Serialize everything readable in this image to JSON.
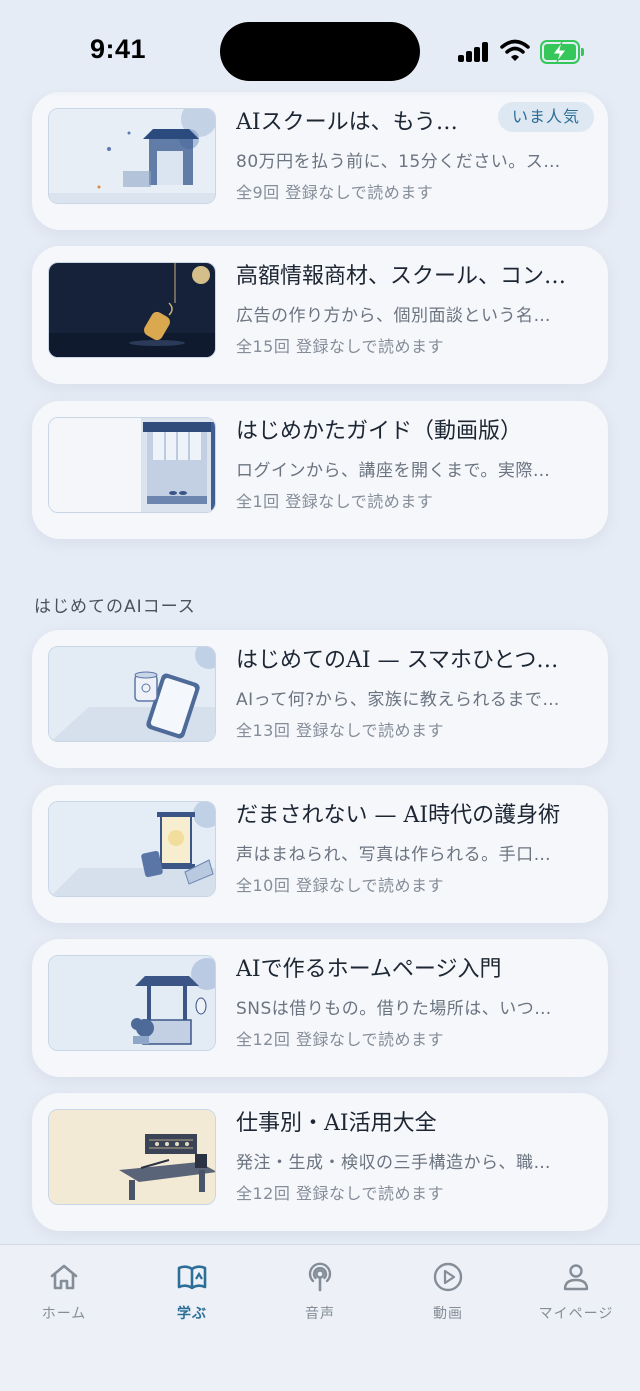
{
  "status_bar": {
    "time": "9:41"
  },
  "cards_top": [
    {
      "title": "AIスクールは、もう…",
      "description": "80万円を払う前に、15分ください。ス…",
      "meta": "全9回 登録なしで読めます",
      "badge": "いま人気",
      "image": "gate-illustration"
    },
    {
      "title": "高額情報商材、スクール、コン…",
      "description": "広告の作り方から、個別面談という名…",
      "meta": "全15回 登録なしで読めます",
      "image": "fishing-lure-illustration"
    },
    {
      "title": "はじめかたガイド（動画版）",
      "description": "ログインから、講座を開くまで。実際…",
      "meta": "全1回 登録なしで読めます",
      "image": "doorway-illustration"
    }
  ],
  "section": {
    "title": "はじめてのAIコース"
  },
  "cards_course": [
    {
      "title": "はじめてのAI — スマホひとつ…",
      "description": "AIって何?から、家族に教えられるまで…",
      "meta": "全13回 登録なしで読めます",
      "image": "phone-tea-illustration"
    },
    {
      "title": "だまされない — AI時代の護身術",
      "description": "声はまねられ、写真は作られる。手口…",
      "meta": "全10回 登録なしで読めます",
      "image": "lantern-illustration"
    },
    {
      "title": "AIで作るホームページ入門",
      "description": "SNSは借りもの。借りた場所は、いつ…",
      "meta": "全12回 登録なしで読めます",
      "image": "well-illustration"
    },
    {
      "title": "仕事別・AI活用大全",
      "description": "発注・生成・検収の三手構造から、職…",
      "meta": "全12回 登録なしで読めます",
      "image": "abacus-desk-illustration"
    }
  ],
  "tabs": [
    {
      "label": "ホーム",
      "icon": "home-icon",
      "active": false
    },
    {
      "label": "学ぶ",
      "icon": "book-icon",
      "active": true
    },
    {
      "label": "音声",
      "icon": "podcast-icon",
      "active": false
    },
    {
      "label": "動画",
      "icon": "play-icon",
      "active": false
    },
    {
      "label": "マイページ",
      "icon": "person-icon",
      "active": false
    }
  ],
  "colors": {
    "accent": "#2c6e97",
    "background": "#e6ecf5",
    "card": "#f5f7fb",
    "battery": "#35c759"
  }
}
